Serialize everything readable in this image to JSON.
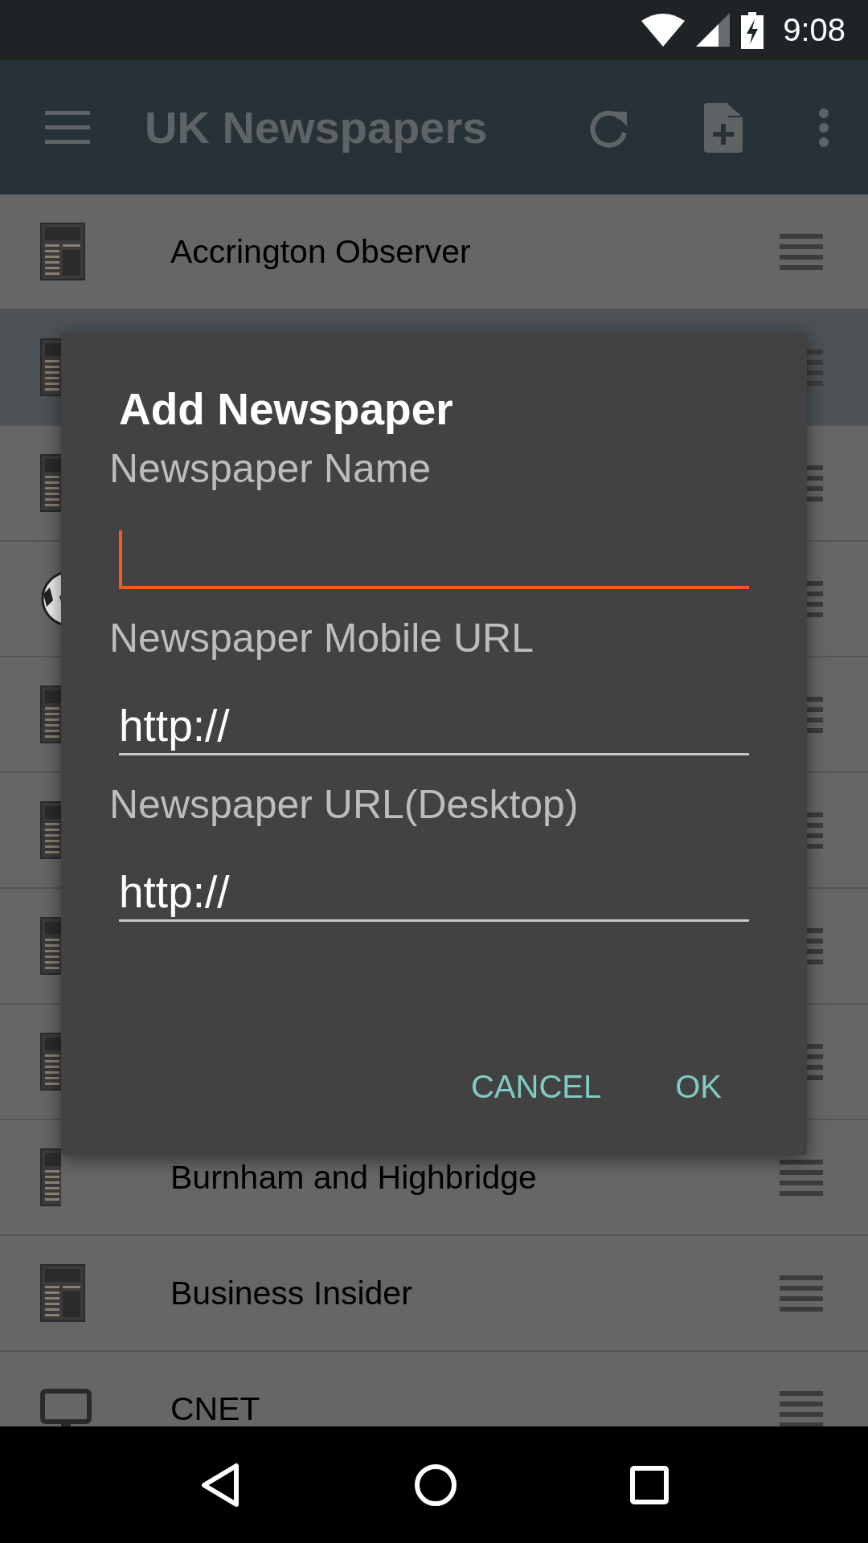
{
  "status_bar": {
    "time": "9:08"
  },
  "app_bar": {
    "title": "UK Newspapers"
  },
  "list": [
    {
      "kind": "newspaper",
      "title": "Accrington Observer",
      "selected": false
    },
    {
      "kind": "newspaper",
      "selected": true
    },
    {
      "kind": "newspaper",
      "selected": false
    },
    {
      "kind": "ball",
      "selected": false
    },
    {
      "kind": "newspaper",
      "selected": false
    },
    {
      "kind": "newspaper",
      "selected": false
    },
    {
      "kind": "newspaper",
      "selected": false
    },
    {
      "kind": "newspaper",
      "selected": false
    },
    {
      "kind": "newspaper",
      "title": "Burnham and Highbridge",
      "selected": false
    },
    {
      "kind": "newspaper",
      "title": "Business Insider",
      "selected": false
    },
    {
      "kind": "monitor",
      "title": "CNET",
      "selected": false
    }
  ],
  "dialog": {
    "title": "Add Newspaper",
    "fields": [
      {
        "label": "Newspaper Name",
        "focused": true
      },
      {
        "label": "Newspaper Mobile URL",
        "value": "http://",
        "focused": false
      },
      {
        "label": "Newspaper URL(Desktop)",
        "value": "http://",
        "focused": false
      }
    ],
    "buttons": [
      "CANCEL",
      "OK"
    ]
  }
}
